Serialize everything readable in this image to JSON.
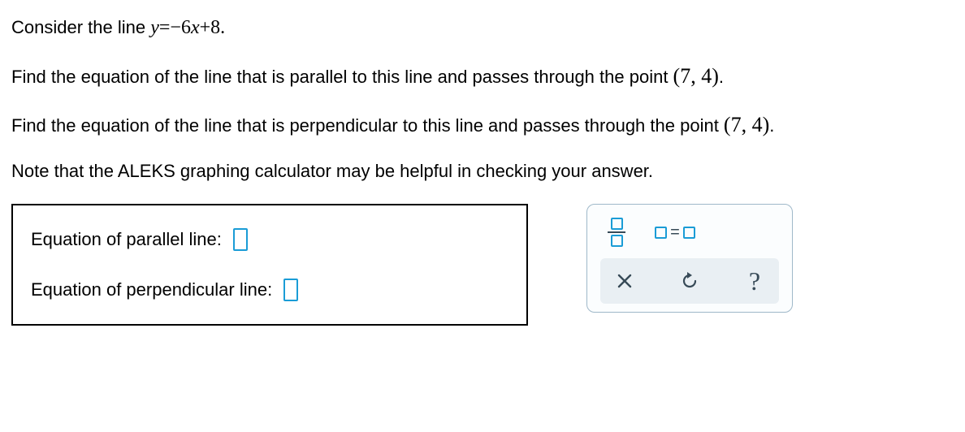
{
  "prompt": {
    "line1_prefix": "Consider the line ",
    "line1_eq_lhs_var": "y",
    "line1_eq_rest": "=−6",
    "line1_eq_xvar": "x",
    "line1_eq_tail": "+8.",
    "line2_prefix": "Find the equation of the line that is parallel to this line and passes through the point ",
    "line2_point": "(7,  4)",
    "line2_suffix": ".",
    "line3_prefix": "Find the equation of the line that is perpendicular to this line and passes through the point ",
    "line3_point": "(7,  4)",
    "line3_suffix": ".",
    "line4": "Note that the ALEKS graphing calculator may be helpful in checking your answer."
  },
  "answers": {
    "parallel_label": "Equation of parallel line:",
    "perpendicular_label": "Equation of perpendicular line:"
  },
  "toolbox": {
    "fraction_name": "fraction-tool",
    "equation_name": "equation-tool",
    "equals_symbol": "=",
    "clear_name": "clear-button",
    "reset_name": "reset-button",
    "help_name": "help-button",
    "help_symbol": "?"
  }
}
